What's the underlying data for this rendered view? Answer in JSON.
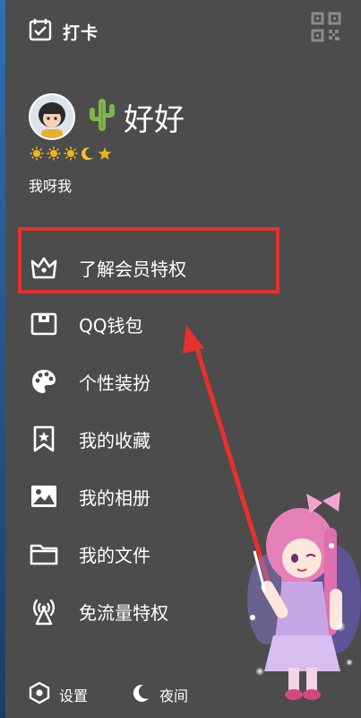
{
  "header": {
    "checkin_label": "打卡"
  },
  "profile": {
    "nickname": "好好"
  },
  "signature": "我呀我",
  "menu": [
    {
      "label": "了解会员特权",
      "icon": "crown-icon"
    },
    {
      "label": "QQ钱包",
      "icon": "wallet-icon"
    },
    {
      "label": "个性装扮",
      "icon": "palette-icon"
    },
    {
      "label": "我的收藏",
      "icon": "bookmark-star-icon"
    },
    {
      "label": "我的相册",
      "icon": "photo-icon"
    },
    {
      "label": "我的文件",
      "icon": "folder-icon"
    },
    {
      "label": "免流量特权",
      "icon": "signal-tower-icon"
    }
  ],
  "bottom": {
    "settings_label": "设置",
    "night_label": "夜间"
  },
  "colors": {
    "panel_bg": "#4c4c4c",
    "highlight_red": "#e8302c",
    "text": "#ffffff",
    "sun": "#f2b21b"
  }
}
